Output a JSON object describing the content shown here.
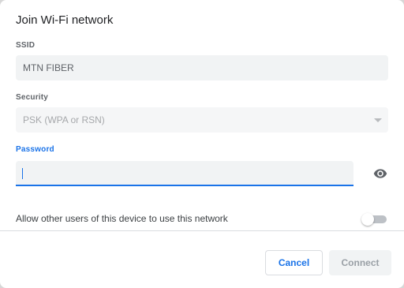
{
  "dialog": {
    "title": "Join Wi-Fi network"
  },
  "ssid": {
    "label": "SSID",
    "value": "MTN FIBER"
  },
  "security": {
    "label": "Security",
    "value": "PSK (WPA or RSN)",
    "icon": "chevron-down-icon"
  },
  "password": {
    "label": "Password",
    "value": "",
    "visibility_icon": "eye-icon"
  },
  "share": {
    "label": "Allow other users of this device to use this network",
    "enabled": false
  },
  "buttons": {
    "cancel": "Cancel",
    "connect": "Connect"
  },
  "colors": {
    "accent": "#1a73e8",
    "disabled_text": "#9aa0a6"
  }
}
